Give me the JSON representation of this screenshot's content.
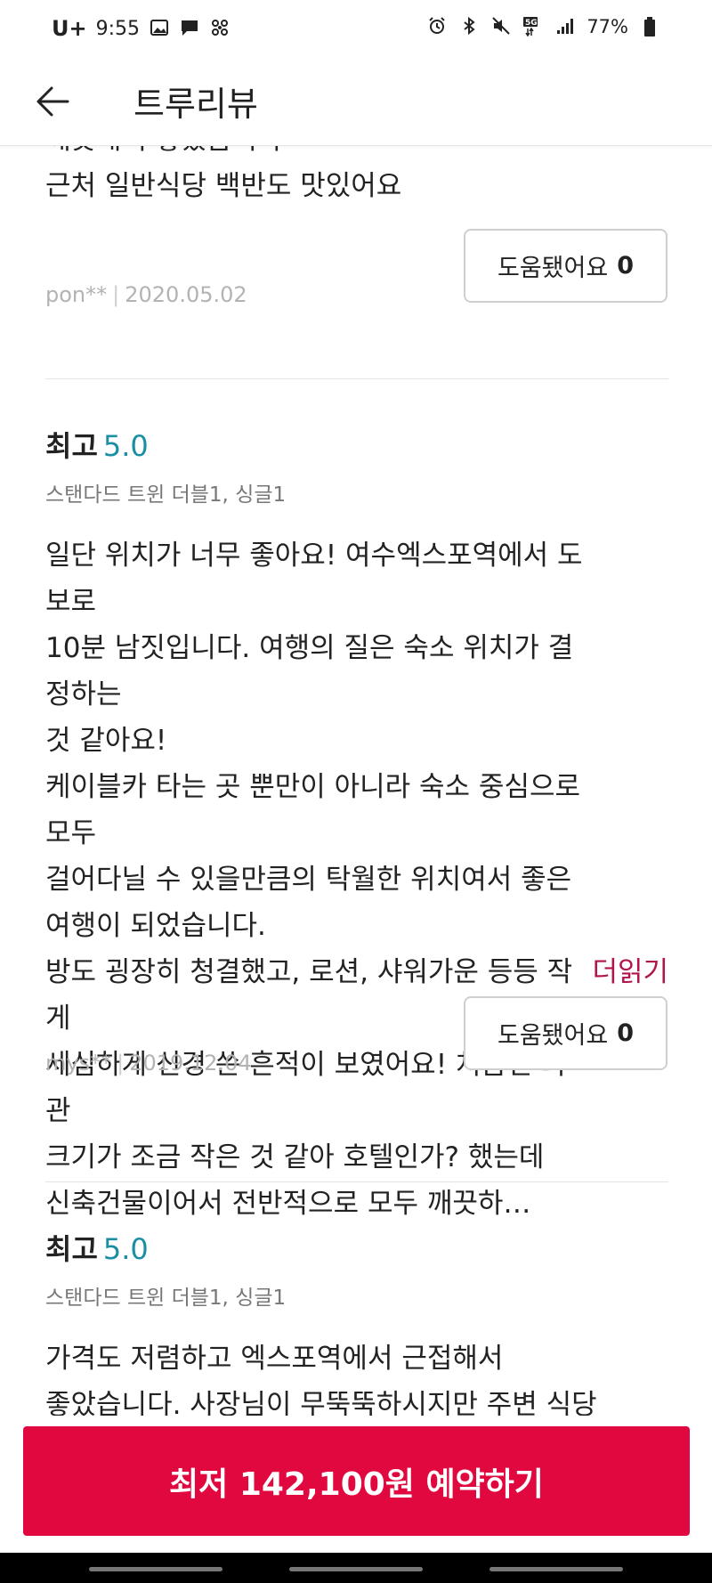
{
  "status_bar": {
    "carrier": "U+",
    "time": "9:55",
    "battery": "77%",
    "network": "5G"
  },
  "header": {
    "title": "트루리뷰"
  },
  "reviews": [
    {
      "text_partial": "깨끗해서 좋았습니다",
      "text": "근처 일반식당 백반도 맛있어요",
      "author": "pon**",
      "date": "2020.05.02",
      "helpful_label": "도움됐어요",
      "helpful_count": "0"
    },
    {
      "rating_label": "최고",
      "score": "5.0",
      "room_type": "스탠다드 트윈 더블1, 싱글1",
      "text": "일단 위치가 너무 좋아요! 여수엑스포역에서 도보로\n10분 남짓입니다. 여행의 질은 숙소 위치가 결정하는\n것 같아요!\n케이블카 타는 곳 뿐만이 아니라 숙소 중심으로 모두\n걸어다닐 수 있을만큼의 탁월한 위치여서 좋은\n여행이 되었습니다.\n방도 굉장히 청결했고, 로션, 샤워가운 등등 작게\n세심하게 신경 쓴 흔적이 보였어요! 처음엔 외관\n크기가 조금 작은 것 같아 호텔인가? 했는데\n신축건물이어서 전반적으로 모두 깨끗하…",
      "more_label": "더읽기",
      "author": "mys**",
      "date": "2019.12.04",
      "helpful_label": "도움됐어요",
      "helpful_count": "0"
    },
    {
      "rating_label": "최고",
      "score": "5.0",
      "room_type": "스탠다드 트윈 더블1, 싱글1",
      "text": "가격도 저렴하고 엑스포역에서 근접해서\n좋았습니다. 사장님이 무뚝뚝하시지만 주변 식당도"
    }
  ],
  "cta": {
    "label": "최저 142,100원 예약하기"
  },
  "colors": {
    "accent": "#e1073f",
    "score": "#1a8fa3",
    "more_link": "#b0154d"
  }
}
